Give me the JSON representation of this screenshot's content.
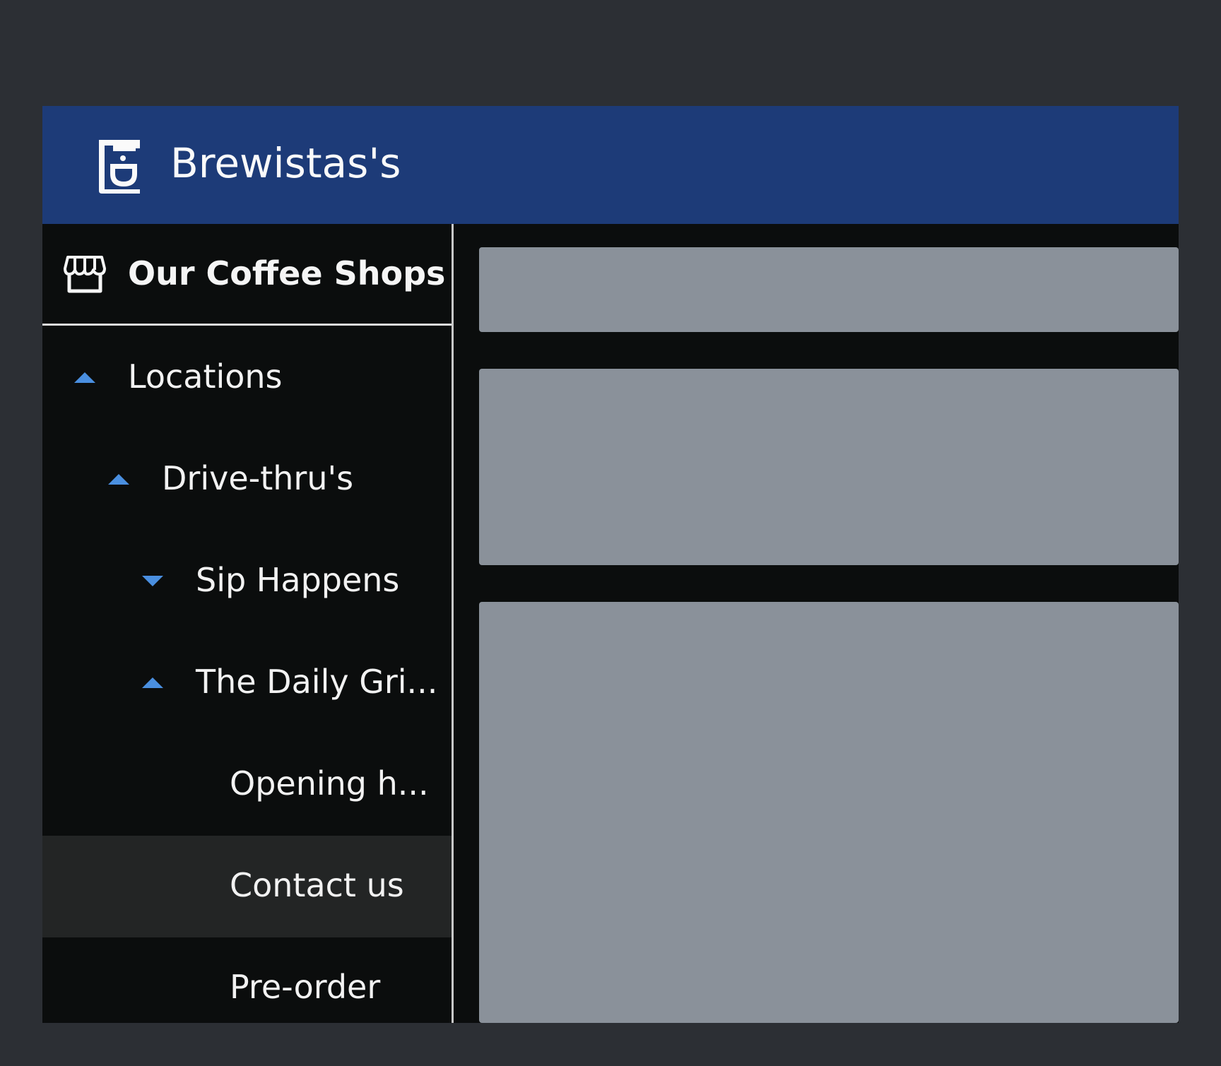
{
  "header": {
    "title": "Brewistas's",
    "logo_icon": "coffee-machine-icon",
    "background": "#1d3b78"
  },
  "sidebar": {
    "title": "Our Coffee Shops",
    "title_icon": "storefront-icon",
    "items": [
      {
        "label": "Locations",
        "level": 0,
        "arrow": "up"
      },
      {
        "label": "Drive-thru's",
        "level": 1,
        "arrow": "up"
      },
      {
        "label": "Sip Happens",
        "level": 2,
        "arrow": "down"
      },
      {
        "label": "The Daily Gri...",
        "level": 2,
        "arrow": "up"
      },
      {
        "label": "Opening h...",
        "level": 3,
        "arrow": null
      },
      {
        "label": "Contact us",
        "level": 3,
        "arrow": null,
        "active": true
      },
      {
        "label": "Pre-order",
        "level": 3,
        "arrow": null
      }
    ]
  },
  "colors": {
    "accent": "#4a8fe0",
    "panel": "#8a919a",
    "sidebar": "#0b0d0d",
    "active_item": "#232525"
  }
}
